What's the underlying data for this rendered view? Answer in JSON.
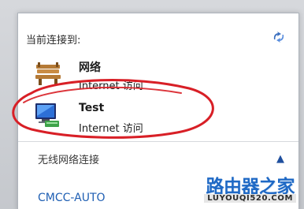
{
  "panel": {
    "header": "当前连接到:",
    "refresh_icon": "refresh-network-icon"
  },
  "connections": [
    {
      "name": "网络",
      "status": "Internet 访问",
      "icon": "network-bench-icon"
    },
    {
      "name": "Test",
      "status": "Internet 访问",
      "icon": "network-computer-icon"
    }
  ],
  "wireless": {
    "title": "无线网络连接",
    "collapse_icon": "chevron-up-icon",
    "networks": [
      "CMCC-AUTO"
    ]
  },
  "watermark": {
    "main": "路由器之家",
    "sub": "LUYOUQI520.COM"
  },
  "colors": {
    "highlight_red": "#d81f26",
    "link_blue": "#1f5fb3"
  }
}
